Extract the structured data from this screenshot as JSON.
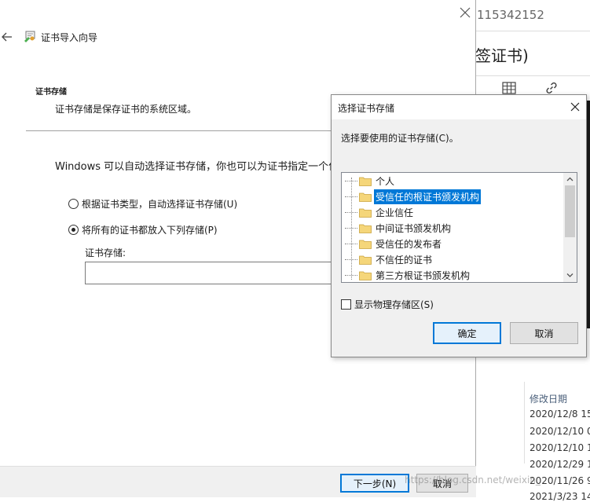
{
  "background_page": {
    "title_number": "115342152",
    "title_sign": "签证书)",
    "date_column_header": "修改日期",
    "date_rows": [
      "2020/12/8 15",
      "2020/12/10 0",
      "2020/12/10 1",
      "2020/12/29 1",
      "2020/11/26 9",
      "2021/3/23 14"
    ]
  },
  "wizard": {
    "title": "证书导入向导",
    "section_heading": "证书存储",
    "section_description": "证书存储是保存证书的系统区域。",
    "intro_text": "Windows 可以自动选择证书存储，你也可以为证书指定一个位置。",
    "radio_auto_label": "根据证书类型，自动选择证书存储(U)",
    "radio_manual_label": "将所有的证书都放入下列存储(P)",
    "store_label": "证书存储:",
    "store_value": "",
    "next_button": "下一步(N)",
    "cancel_button": "取消"
  },
  "dialog": {
    "title": "选择证书存储",
    "prompt": "选择要使用的证书存储(C)。",
    "stores": [
      "个人",
      "受信任的根证书颁发机构",
      "企业信任",
      "中间证书颁发机构",
      "受信任的发布者",
      "不信任的证书",
      "第三方根证书颁发机构"
    ],
    "selected_store": "受信任的根证书颁发机构",
    "show_physical_label": "显示物理存储区(S)",
    "ok_button": "确定",
    "cancel_button": "取消"
  },
  "watermark": "https://blog.csdn.net/weixin_",
  "colors": {
    "accent": "#0078d7",
    "selection_bg": "#0078d7",
    "dialog_bg": "#f0f0f0",
    "folder": "#e8c25a"
  }
}
